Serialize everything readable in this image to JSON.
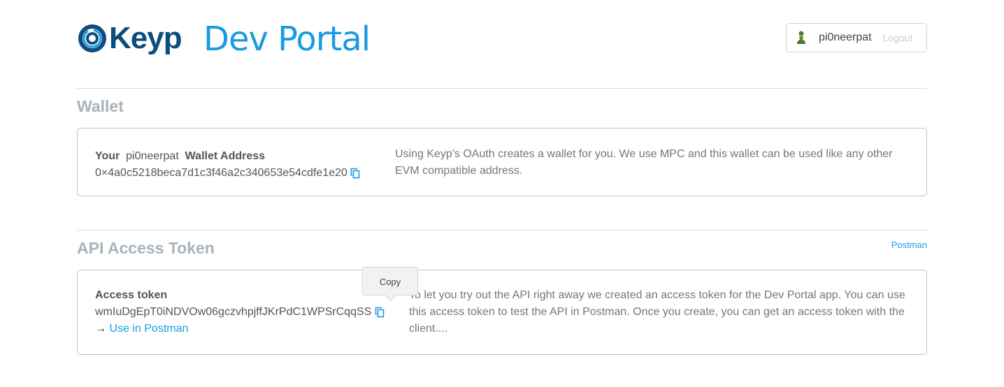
{
  "header": {
    "logo_text": "Keyp",
    "title": "Dev Portal",
    "user": {
      "name": "pi0neerpat",
      "avatar_icon": "pawn-icon",
      "logout_label": "Logout"
    }
  },
  "colors": {
    "brand_dark": "#0c4d7e",
    "brand_light": "#1a9be0"
  },
  "wallet": {
    "section_title": "Wallet",
    "label_prefix": "Your",
    "label_user": "pi0neerpat",
    "label_suffix": "Wallet Address",
    "address": "0×4a0c5218beca7d1c3f46a2c340653e54cdfe1e20",
    "description": "Using Keyp's OAuth creates a wallet for you. We use MPC and this wallet can be used like any other EVM compatible address."
  },
  "api": {
    "section_title": "API Access Token",
    "postman_link": "Postman",
    "label": "Access token",
    "token": "wmIuDgEpT0iNDVOw06gczvhpjffJKrPdC1WPSrCqqSS",
    "arrow": "→",
    "use_link": "Use in Postman",
    "description": "To let you try out the API right away we created an access token for the Dev Portal app. You can use this access token to test the API in Postman. Once you create, you can get an access token with the client....",
    "tooltip": "Copy"
  }
}
